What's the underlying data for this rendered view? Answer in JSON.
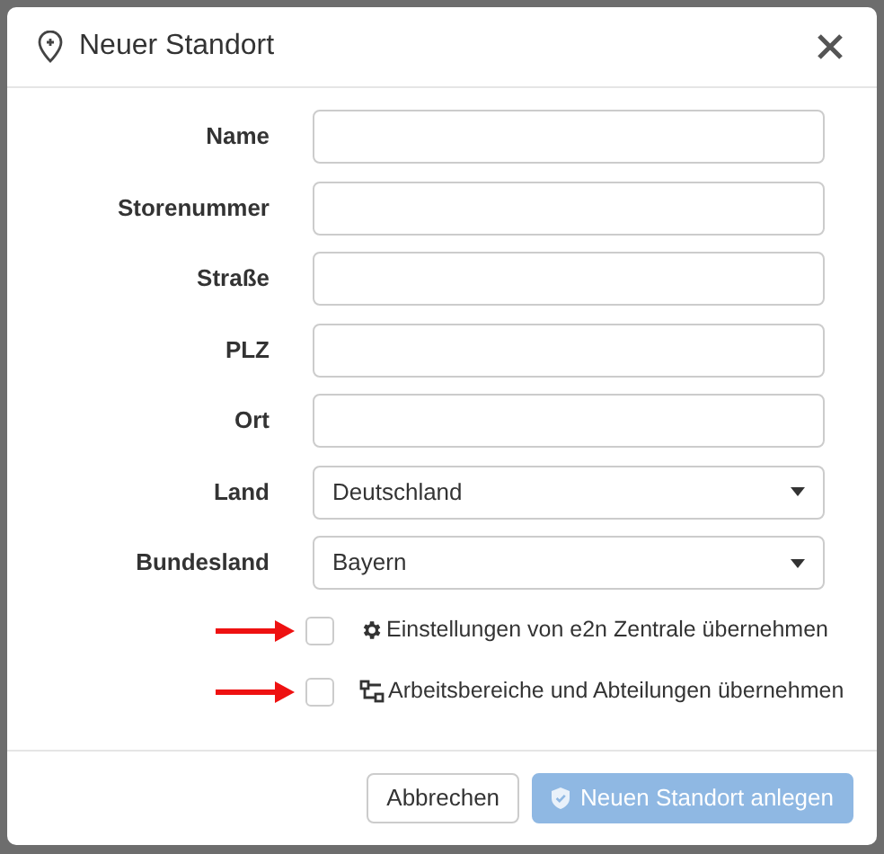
{
  "dialog": {
    "title": "Neuer Standort"
  },
  "fields": [
    {
      "label": "Name",
      "kind": "text"
    },
    {
      "label": "Storenummer",
      "kind": "text"
    },
    {
      "label": "Straße",
      "kind": "text"
    },
    {
      "label": "PLZ",
      "kind": "text"
    },
    {
      "label": "Ort",
      "kind": "text"
    },
    {
      "label": "Land",
      "kind": "select",
      "value": "Deutschland"
    },
    {
      "label": "Bundesland",
      "kind": "select",
      "value": "Bayern"
    }
  ],
  "options": [
    {
      "label": "Einstellungen von e2n Zentrale übernehmen",
      "checked": false,
      "kind": "gear"
    },
    {
      "label": "Arbeitsbereiche und Abteilungen übernehmen",
      "checked": false,
      "kind": "structure"
    }
  ],
  "buttons": [
    {
      "label": "Abbrechen",
      "kind": "secondary",
      "disabled": false
    },
    {
      "label": "Neuen Standort anlegen",
      "kind": "primary",
      "disabled": true
    }
  ]
}
